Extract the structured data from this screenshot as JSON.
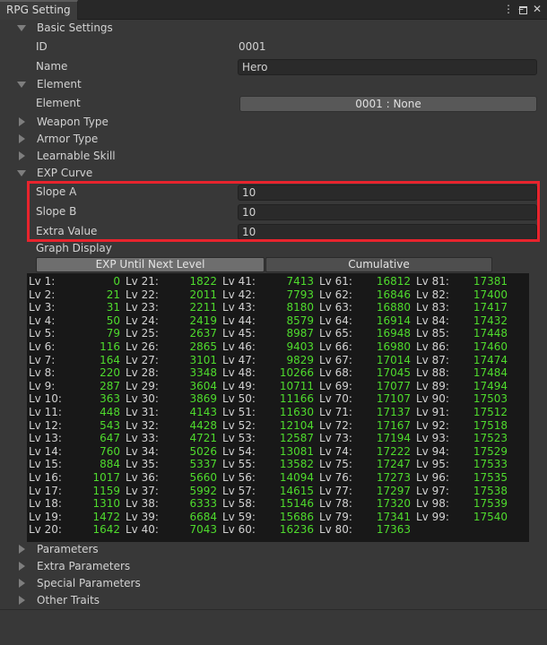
{
  "window": {
    "title": "RPG Setting",
    "controls": {
      "menu": "⋮",
      "minimize": "–",
      "close": "✕"
    }
  },
  "basic_settings": {
    "header": "Basic Settings",
    "id_label": "ID",
    "id_value": "0001",
    "name_label": "Name",
    "name_value": "Hero"
  },
  "element": {
    "header": "Element",
    "field_label": "Element",
    "field_value": "0001 : None"
  },
  "collapsed_sections_top": [
    "Weapon Type",
    "Armor Type",
    "Learnable Skill"
  ],
  "exp_curve": {
    "header": "EXP Curve",
    "slope_a_label": "Slope A",
    "slope_a_value": "10",
    "slope_b_label": "Slope B",
    "slope_b_value": "10",
    "extra_label": "Extra Value",
    "extra_value": "10",
    "graph_display_label": "Graph Display",
    "tab_exp_next": "EXP Until Next Level",
    "tab_cumulative": "Cumulative",
    "highlight_color": "#e8242d",
    "value_color": "#4fdc2d"
  },
  "exp_table": {
    "col1": [
      {
        "lv": "Lv 1:",
        "val": "0"
      },
      {
        "lv": "Lv 2:",
        "val": "21"
      },
      {
        "lv": "Lv 3:",
        "val": "31"
      },
      {
        "lv": "Lv 4:",
        "val": "50"
      },
      {
        "lv": "Lv 5:",
        "val": "79"
      },
      {
        "lv": "Lv 6:",
        "val": "116"
      },
      {
        "lv": "Lv 7:",
        "val": "164"
      },
      {
        "lv": "Lv 8:",
        "val": "220"
      },
      {
        "lv": "Lv 9:",
        "val": "287"
      },
      {
        "lv": "Lv 10:",
        "val": "363"
      },
      {
        "lv": "Lv 11:",
        "val": "448"
      },
      {
        "lv": "Lv 12:",
        "val": "543"
      },
      {
        "lv": "Lv 13:",
        "val": "647"
      },
      {
        "lv": "Lv 14:",
        "val": "760"
      },
      {
        "lv": "Lv 15:",
        "val": "884"
      },
      {
        "lv": "Lv 16:",
        "val": "1017"
      },
      {
        "lv": "Lv 17:",
        "val": "1159"
      },
      {
        "lv": "Lv 18:",
        "val": "1310"
      },
      {
        "lv": "Lv 19:",
        "val": "1472"
      },
      {
        "lv": "Lv 20:",
        "val": "1642"
      }
    ],
    "col2": [
      {
        "lv": "Lv 21:",
        "val": "1822"
      },
      {
        "lv": "Lv 22:",
        "val": "2011"
      },
      {
        "lv": "Lv 23:",
        "val": "2211"
      },
      {
        "lv": "Lv 24:",
        "val": "2419"
      },
      {
        "lv": "Lv 25:",
        "val": "2637"
      },
      {
        "lv": "Lv 26:",
        "val": "2865"
      },
      {
        "lv": "Lv 27:",
        "val": "3101"
      },
      {
        "lv": "Lv 28:",
        "val": "3348"
      },
      {
        "lv": "Lv 29:",
        "val": "3604"
      },
      {
        "lv": "Lv 30:",
        "val": "3869"
      },
      {
        "lv": "Lv 31:",
        "val": "4143"
      },
      {
        "lv": "Lv 32:",
        "val": "4428"
      },
      {
        "lv": "Lv 33:",
        "val": "4721"
      },
      {
        "lv": "Lv 34:",
        "val": "5026"
      },
      {
        "lv": "Lv 35:",
        "val": "5337"
      },
      {
        "lv": "Lv 36:",
        "val": "5660"
      },
      {
        "lv": "Lv 37:",
        "val": "5992"
      },
      {
        "lv": "Lv 38:",
        "val": "6333"
      },
      {
        "lv": "Lv 39:",
        "val": "6684"
      },
      {
        "lv": "Lv 40:",
        "val": "7043"
      }
    ],
    "col3": [
      {
        "lv": "Lv 41:",
        "val": "7413"
      },
      {
        "lv": "Lv 42:",
        "val": "7793"
      },
      {
        "lv": "Lv 43:",
        "val": "8180"
      },
      {
        "lv": "Lv 44:",
        "val": "8579"
      },
      {
        "lv": "Lv 45:",
        "val": "8987"
      },
      {
        "lv": "Lv 46:",
        "val": "9403"
      },
      {
        "lv": "Lv 47:",
        "val": "9829"
      },
      {
        "lv": "Lv 48:",
        "val": "10266"
      },
      {
        "lv": "Lv 49:",
        "val": "10711"
      },
      {
        "lv": "Lv 50:",
        "val": "11166"
      },
      {
        "lv": "Lv 51:",
        "val": "11630"
      },
      {
        "lv": "Lv 52:",
        "val": "12104"
      },
      {
        "lv": "Lv 53:",
        "val": "12587"
      },
      {
        "lv": "Lv 54:",
        "val": "13081"
      },
      {
        "lv": "Lv 55:",
        "val": "13582"
      },
      {
        "lv": "Lv 56:",
        "val": "14094"
      },
      {
        "lv": "Lv 57:",
        "val": "14615"
      },
      {
        "lv": "Lv 58:",
        "val": "15146"
      },
      {
        "lv": "Lv 59:",
        "val": "15686"
      },
      {
        "lv": "Lv 60:",
        "val": "16236"
      }
    ],
    "col4": [
      {
        "lv": "Lv 61:",
        "val": "16812"
      },
      {
        "lv": "Lv 62:",
        "val": "16846"
      },
      {
        "lv": "Lv 63:",
        "val": "16880"
      },
      {
        "lv": "Lv 64:",
        "val": "16914"
      },
      {
        "lv": "Lv 65:",
        "val": "16948"
      },
      {
        "lv": "Lv 66:",
        "val": "16980"
      },
      {
        "lv": "Lv 67:",
        "val": "17014"
      },
      {
        "lv": "Lv 68:",
        "val": "17045"
      },
      {
        "lv": "Lv 69:",
        "val": "17077"
      },
      {
        "lv": "Lv 70:",
        "val": "17107"
      },
      {
        "lv": "Lv 71:",
        "val": "17137"
      },
      {
        "lv": "Lv 72:",
        "val": "17167"
      },
      {
        "lv": "Lv 73:",
        "val": "17194"
      },
      {
        "lv": "Lv 74:",
        "val": "17222"
      },
      {
        "lv": "Lv 75:",
        "val": "17247"
      },
      {
        "lv": "Lv 76:",
        "val": "17273"
      },
      {
        "lv": "Lv 77:",
        "val": "17297"
      },
      {
        "lv": "Lv 78:",
        "val": "17320"
      },
      {
        "lv": "Lv 79:",
        "val": "17341"
      },
      {
        "lv": "Lv 80:",
        "val": "17363"
      }
    ],
    "col5": [
      {
        "lv": "Lv 81:",
        "val": "17381"
      },
      {
        "lv": "Lv 82:",
        "val": "17400"
      },
      {
        "lv": "Lv 83:",
        "val": "17417"
      },
      {
        "lv": "Lv 84:",
        "val": "17432"
      },
      {
        "lv": "Lv 85:",
        "val": "17448"
      },
      {
        "lv": "Lv 86:",
        "val": "17460"
      },
      {
        "lv": "Lv 87:",
        "val": "17474"
      },
      {
        "lv": "Lv 88:",
        "val": "17484"
      },
      {
        "lv": "Lv 89:",
        "val": "17494"
      },
      {
        "lv": "Lv 90:",
        "val": "17503"
      },
      {
        "lv": "Lv 91:",
        "val": "17512"
      },
      {
        "lv": "Lv 92:",
        "val": "17518"
      },
      {
        "lv": "Lv 93:",
        "val": "17523"
      },
      {
        "lv": "Lv 94:",
        "val": "17529"
      },
      {
        "lv": "Lv 95:",
        "val": "17533"
      },
      {
        "lv": "Lv 96:",
        "val": "17535"
      },
      {
        "lv": "Lv 97:",
        "val": "17538"
      },
      {
        "lv": "Lv 98:",
        "val": "17539"
      },
      {
        "lv": "Lv 99:",
        "val": "17540"
      }
    ]
  },
  "collapsed_sections_bottom": [
    "Parameters",
    "Extra Parameters",
    "Special Parameters",
    "Other Traits"
  ]
}
